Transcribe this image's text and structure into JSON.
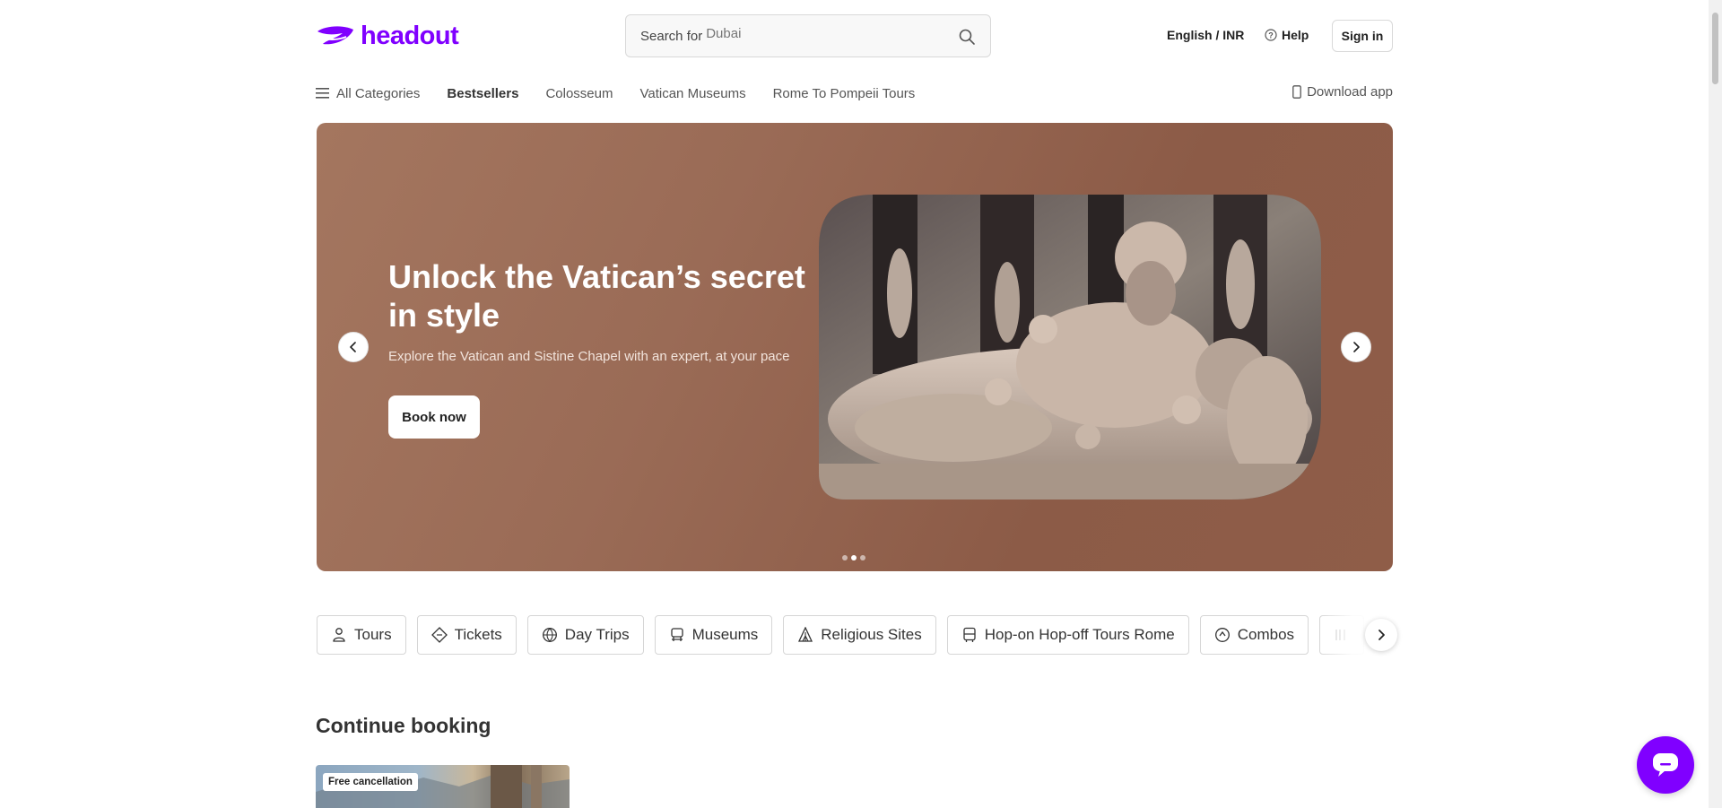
{
  "header": {
    "logo_text": "headout",
    "search_label": "Search for",
    "search_placeholder": "Dubai",
    "language_currency": "English / INR",
    "help_label": "Help",
    "signin_label": "Sign in"
  },
  "nav": {
    "items": [
      {
        "label": "All Categories"
      },
      {
        "label": "Bestsellers"
      },
      {
        "label": "Colosseum"
      },
      {
        "label": "Vatican Museums"
      },
      {
        "label": "Rome To Pompeii Tours"
      }
    ],
    "download_label": "Download app"
  },
  "hero": {
    "title": "Unlock the Vatican’s secret in style",
    "subtitle": "Explore the Vatican and Sistine Chapel with an expert, at your pace",
    "cta_label": "Book now",
    "slide_count": 3,
    "active_slide": 2
  },
  "categories": [
    {
      "label": "Tours",
      "icon": "tour-guide-icon"
    },
    {
      "label": "Tickets",
      "icon": "ticket-icon"
    },
    {
      "label": "Day Trips",
      "icon": "globe-icon"
    },
    {
      "label": "Museums",
      "icon": "museum-icon"
    },
    {
      "label": "Religious Sites",
      "icon": "church-icon"
    },
    {
      "label": "Hop-on Hop-off Tours Rome",
      "icon": "bus-icon"
    },
    {
      "label": "Combos",
      "icon": "combo-icon"
    }
  ],
  "continue_booking": {
    "title": "Continue booking",
    "badge": "Free cancellation"
  },
  "colors": {
    "brand": "#8000ff",
    "hero_bg": "#9a6b56"
  }
}
